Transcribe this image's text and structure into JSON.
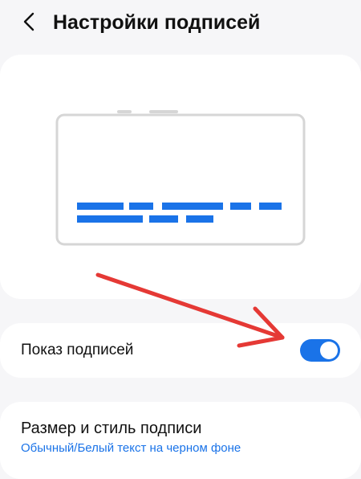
{
  "header": {
    "back_icon": "chevron-left-icon",
    "title": "Настройки подписей"
  },
  "preview": {
    "illustration": "caption-preview-screen"
  },
  "caption_toggle": {
    "label": "Показ подписей",
    "enabled": true
  },
  "caption_style": {
    "title": "Размер и стиль подписи",
    "value": "Обычный/Белый текст на черном фоне"
  },
  "annotation": {
    "icon": "red-arrow-icon",
    "color": "#e53935"
  },
  "colors": {
    "accent": "#1a73e8",
    "background": "#f6f6f8",
    "card": "#ffffff"
  }
}
